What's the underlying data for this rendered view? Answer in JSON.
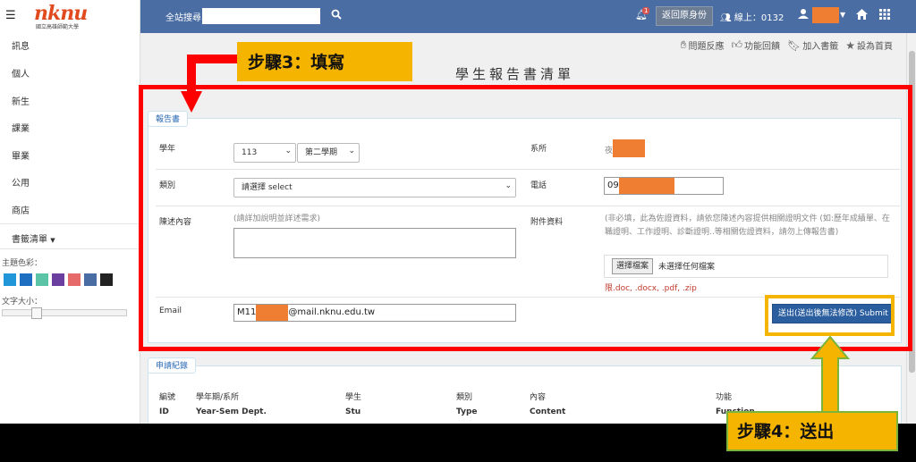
{
  "sidebar": {
    "logo_text": "nknu",
    "logo_sub": "國立高雄師範大學",
    "items": [
      {
        "label": "訊息"
      },
      {
        "label": "個人"
      },
      {
        "label": "新生"
      },
      {
        "label": "課業"
      },
      {
        "label": "畢業"
      },
      {
        "label": "公用"
      },
      {
        "label": "商店"
      }
    ],
    "bookmarks": "書籤清單",
    "theme_label": "主題色彩：",
    "theme_colors": [
      "#2196d9",
      "#1e6fc2",
      "#5bc4a6",
      "#6a3fa0",
      "#e66a6a",
      "#4a6da3",
      "#222222"
    ],
    "font_size_label": "文字大小："
  },
  "topbar": {
    "search_label": "全站搜尋",
    "search_value": "",
    "bell_badge": "1",
    "return_button": "返回原身份",
    "online_label": "線上：0132"
  },
  "quick_links": [
    "問題反應",
    "功能回饋",
    "加入書籤",
    "設為首頁"
  ],
  "page_title": "學生報告書清單",
  "form": {
    "legend": "報告書",
    "year_label": "學年",
    "year_value": "113",
    "semester_value": "第二學期",
    "dept_label": "系所",
    "dept_value": "夜",
    "category_label": "類別",
    "category_value": "請選擇 select",
    "phone_label": "電話",
    "phone_value": "09",
    "statement_label": "陳述內容",
    "statement_hint": "(請詳加說明並詳述需求)",
    "attachment_label": "附件資料",
    "attachment_hint": "(非必填，此為佐證資料，請依您陳述內容提供相關證明文件 (如:歷年成績單、在職證明、工作證明、診斷證明..等相關佐證資料，請勿上傳報告書)",
    "file_button": "選擇檔案",
    "file_status": "未選擇任何檔案",
    "file_types": "限.doc, .docx, .pdf, .zip",
    "email_label": "Email",
    "email_prefix": "M11",
    "email_suffix": "@mail.nknu.edu.tw",
    "submit_button": "送出(送出後無法修改) Submit"
  },
  "history": {
    "legend": "申請紀錄",
    "columns": [
      {
        "zh": "編號",
        "en": "ID"
      },
      {
        "zh": "學年期/系所",
        "en": "Year-Sem Dept."
      },
      {
        "zh": "學生",
        "en": "Stu"
      },
      {
        "zh": "類別",
        "en": "Type"
      },
      {
        "zh": "內容",
        "en": "Content"
      },
      {
        "zh": "功能",
        "en": "Function"
      }
    ]
  },
  "annotations": {
    "step3": "步驟3：填寫",
    "step4": "步驟4：送出",
    "red": "#ff0000",
    "yellow": "#f5b400",
    "green": "#7ab43a"
  }
}
